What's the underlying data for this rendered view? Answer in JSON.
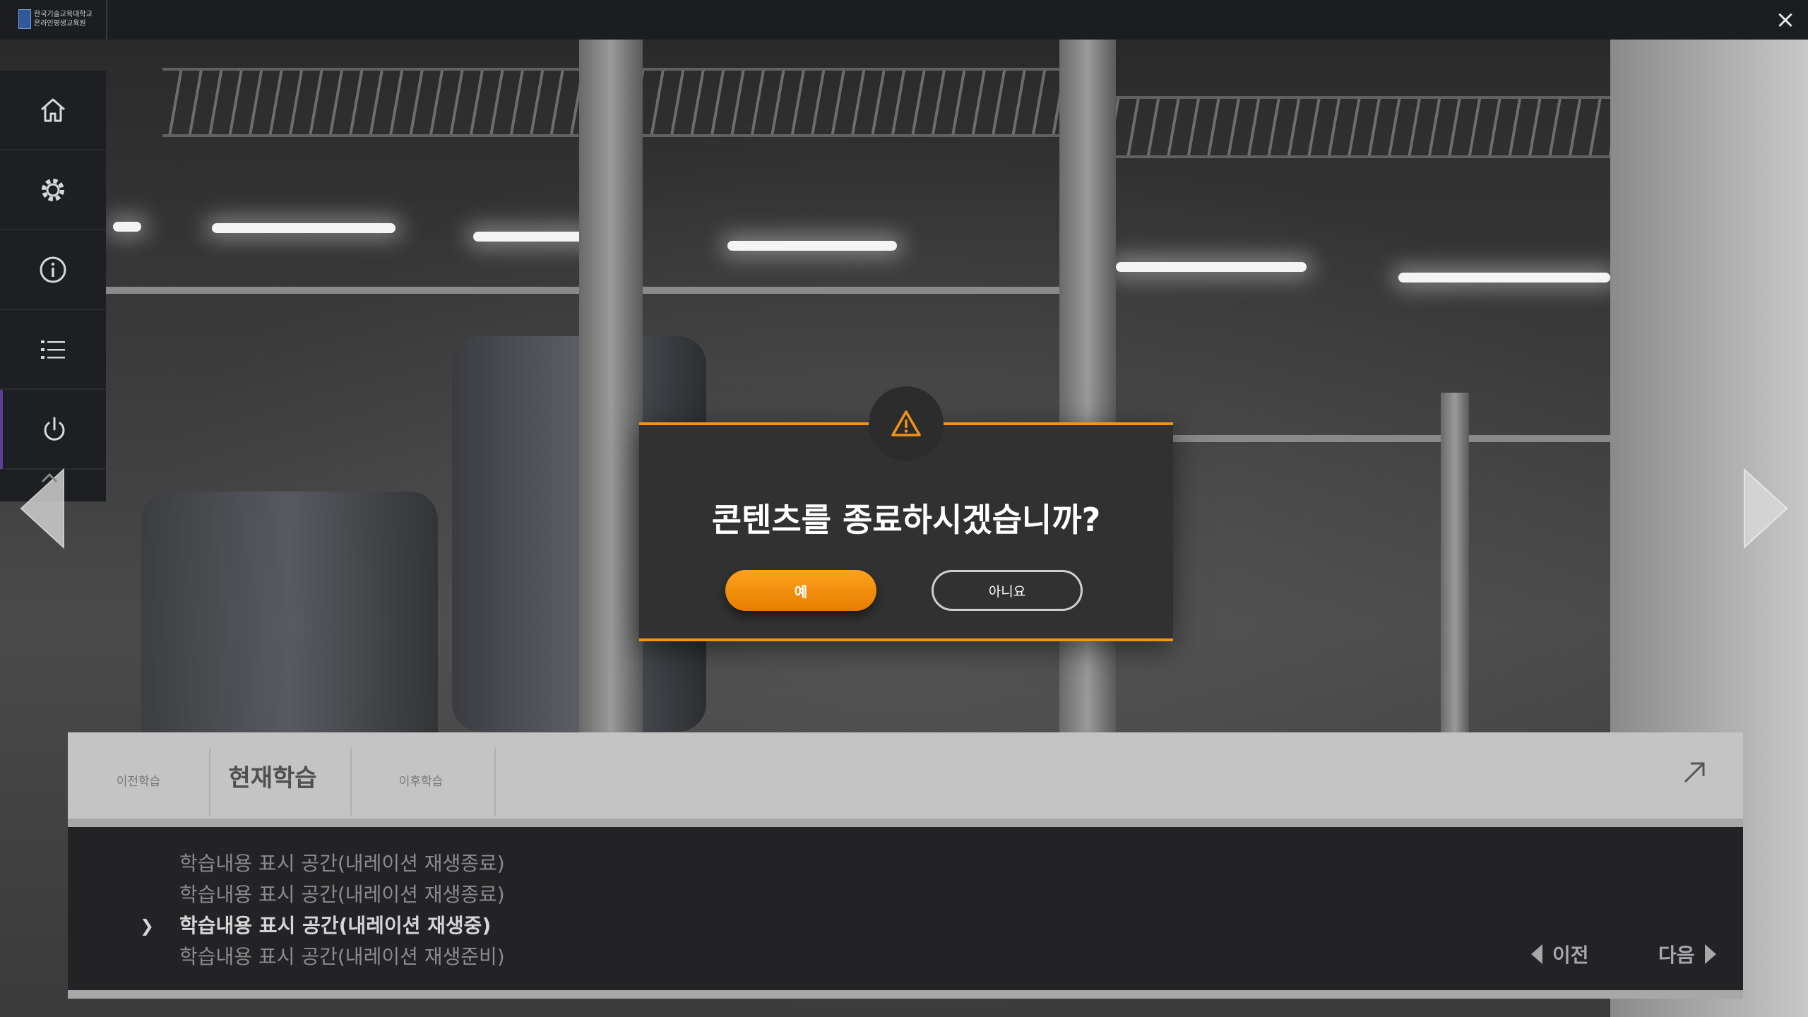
{
  "header": {
    "logo_line1": "한국기술교육대학교",
    "logo_line2": "온라인평생교육원",
    "close_icon": "×"
  },
  "sidebar": {
    "items": [
      {
        "name": "home",
        "icon": "home-icon"
      },
      {
        "name": "settings",
        "icon": "gear-icon"
      },
      {
        "name": "info",
        "icon": "info-icon"
      },
      {
        "name": "contents-list",
        "icon": "list-icon"
      },
      {
        "name": "power",
        "icon": "power-icon"
      }
    ]
  },
  "modal": {
    "title": "콘텐츠를 종료하시겠습니까?",
    "yes_label": "예",
    "no_label": "아니요",
    "icon": "warning-icon",
    "accent_color": "#f29414"
  },
  "bottom": {
    "tabs": {
      "prev": "이전학습",
      "current": "현재학습",
      "next": "이후학습"
    },
    "lines": [
      "학습내용 표시 공간(내레이션 재생종료)",
      "학습내용 표시 공간(내레이션 재생종료)",
      "학습내용 표시 공간(내레이션 재생중)",
      "학습내용 표시 공간(내레이션 재생준비)"
    ],
    "nav_prev": "이전",
    "nav_next": "다음"
  }
}
